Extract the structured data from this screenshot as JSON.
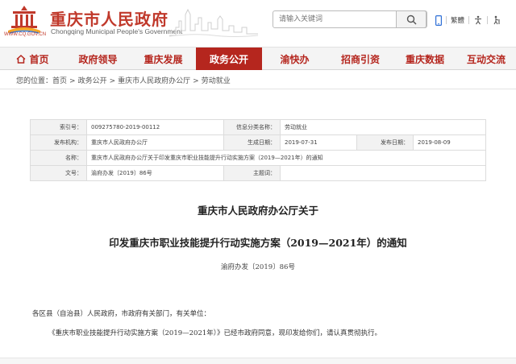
{
  "header": {
    "site_title": "重庆市人民政府",
    "site_subtitle": "Chongqing Municipal People's Government",
    "logo_url_text": "WWW.CQ.GOV.CN",
    "search_placeholder": "请输入关键词",
    "tools": {
      "traditional_label": "繁體"
    },
    "colors": {
      "brand": "#c0392b",
      "nav_active": "#b5261e"
    }
  },
  "nav": {
    "items": [
      {
        "label": "首页",
        "icon": "home-icon"
      },
      {
        "label": "政府领导"
      },
      {
        "label": "重庆发展"
      },
      {
        "label": "政务公开",
        "active": true
      },
      {
        "label": "渝快办"
      },
      {
        "label": "招商引资"
      },
      {
        "label": "重庆数据"
      },
      {
        "label": "互动交流"
      }
    ]
  },
  "breadcrumb": {
    "prefix": "您的位置：",
    "items": [
      "首页",
      "政务公开",
      "重庆市人民政府办公厅",
      "劳动就业"
    ],
    "separator": ">"
  },
  "info": {
    "index_label": "索引号：",
    "index_value": "009275780-2019-00112",
    "category_label": "信息分类名称：",
    "category_value": "劳动就业",
    "issuer_label": "发布机构：",
    "issuer_value": "重庆市人民政府办公厅",
    "generated_label": "生成日期：",
    "generated_value": "2019-07-31",
    "published_label": "发布日期：",
    "published_value": "2019-08-09",
    "name_label": "名称：",
    "name_value": "重庆市人民政府办公厅关于印发重庆市职业技能提升行动实施方案（2019—2021年）的通知",
    "docno_label": "文号：",
    "docno_value": "渝府办发〔2019〕86号",
    "subject_label": "主题词：",
    "subject_value": ""
  },
  "article": {
    "title_line1": "重庆市人民政府办公厅关于",
    "title_line2": "印发重庆市职业技能提升行动实施方案（2019—2021年）的通知",
    "doc_number": "渝府办发〔2019〕86号",
    "para1": "各区县（自治县）人民政府，市政府有关部门，有关单位：",
    "para2": "《重庆市职业技能提升行动实施方案（2019—2021年）》已经市政府同意，现印发给你们，请认真贯彻执行。"
  }
}
